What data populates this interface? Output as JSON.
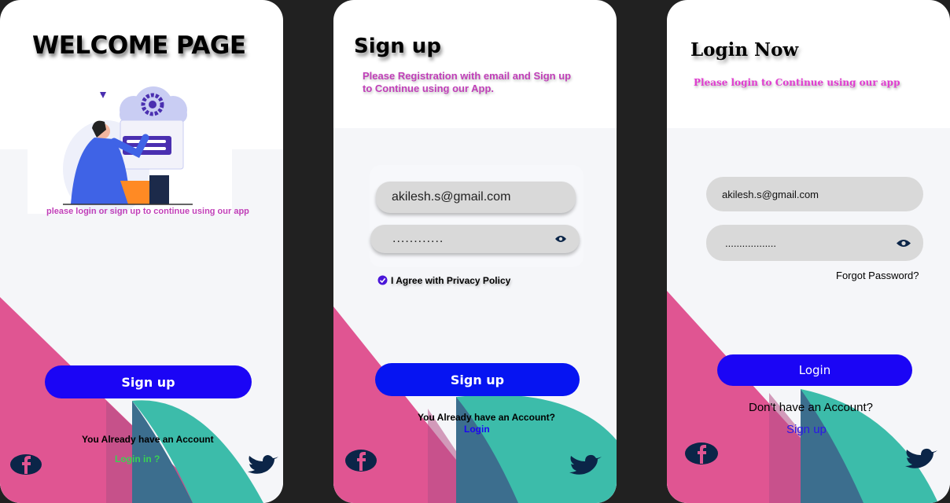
{
  "screens": {
    "welcome": {
      "title": "WELCOME PAGE",
      "subtitle": "please login or sign up to continue using our app",
      "signup_button": "Sign up",
      "account_text": "You Already have an Account",
      "login_link": "Login in ?"
    },
    "signup": {
      "title": "Sign up",
      "subtitle_line1": "Please Registration with email and Sign up",
      "subtitle_line2": "to Continue using our App.",
      "email_value": "akilesh.s@gmail.com",
      "password_value": "............",
      "agree_label": "I Agree with Privacy Policy",
      "signup_button": "Sign up",
      "account_text": "You Already have an Account?",
      "login_link": "Login"
    },
    "login": {
      "title": "Login Now",
      "subtitle": "Please login to Continue using our app",
      "email_value": "akilesh.s@gmail.com",
      "password_value": "..................",
      "forgot_link": "Forgot Password?",
      "login_button": "Login",
      "no_account_text": "Don't have an Account?",
      "signup_link": "Sign up"
    }
  },
  "icons": [
    "facebook-icon",
    "twitter-icon",
    "eye-icon",
    "check-icon"
  ],
  "colors": {
    "button": "#1b05f5",
    "subtitle": "#c03fb8",
    "login_green": "#39d353",
    "link_blue": "#1b05f5",
    "pink": "#e05592",
    "teal": "#3cbcaa",
    "icon_navy": "#0b2548"
  }
}
